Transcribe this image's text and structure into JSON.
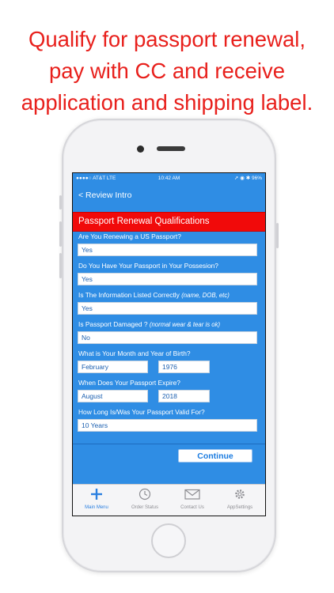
{
  "headline": [
    "Qualify for passport renewal,",
    "pay with CC and receive",
    "application and shipping label."
  ],
  "status_bar": {
    "carrier": "●●●●○ AT&T  LTE",
    "time": "10:42 AM",
    "right": "➚ ◉ ✱ 96%"
  },
  "nav": {
    "back_label": "< Review Intro"
  },
  "section_title": "Passport Renewal Qualifications",
  "form": {
    "q1": {
      "label": "Are You Renewing a US Passport?",
      "value": "Yes"
    },
    "q2": {
      "label": "Do You Have Your Passport in Your Possesion?",
      "value": "Yes"
    },
    "q3": {
      "label": "Is The Information Listed Correctly",
      "hint": "(name, DOB, etc)",
      "value": "Yes"
    },
    "q4": {
      "label": "Is Passport Damaged ?",
      "hint": "(normal wear & tear is ok)",
      "value": "No"
    },
    "q5": {
      "label": "What is Your Month and Year of Birth?",
      "month": "February",
      "year": "1976"
    },
    "q6": {
      "label": "When Does Your Passport Expire?",
      "month": "August",
      "year": "2018"
    },
    "q7": {
      "label": "How Long Is/Was Your Passport Valid For?",
      "value": "10 Years"
    }
  },
  "continue_label": "Continue",
  "tabs": [
    {
      "label": "Main Menu",
      "icon": "plus-icon",
      "active": true
    },
    {
      "label": "Order Status",
      "icon": "clock-icon",
      "active": false
    },
    {
      "label": "Contact Us",
      "icon": "envelope-icon",
      "active": false
    },
    {
      "label": "AppSettings",
      "icon": "gear-icon",
      "active": false
    }
  ],
  "colors": {
    "headline": "#e8201c",
    "app_blue": "#2f8de4",
    "section_red": "#f10a0a",
    "tab_active": "#2a7fe0"
  }
}
